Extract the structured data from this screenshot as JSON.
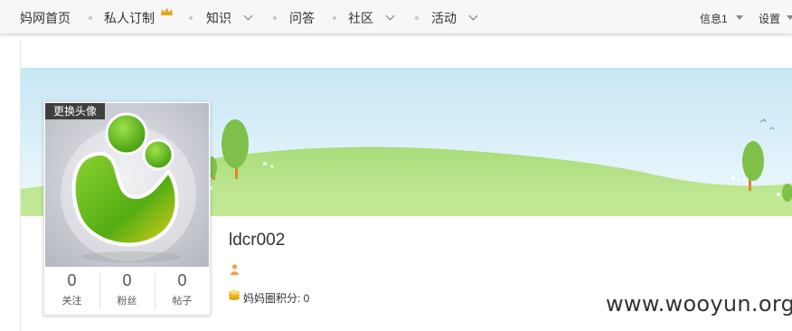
{
  "nav": {
    "items": [
      "妈网首页",
      "私人订制",
      "知识",
      "问答",
      "社区",
      "活动"
    ],
    "right": {
      "messages": "信息1",
      "settings": "设置"
    }
  },
  "profile": {
    "change_avatar": "更换头像",
    "username": "ldcr002",
    "stats": [
      {
        "value": "0",
        "label": "关注"
      },
      {
        "value": "0",
        "label": "粉丝"
      },
      {
        "value": "0",
        "label": "帖子"
      }
    ],
    "points_label": "妈妈圈积分: ",
    "points_value": "0"
  },
  "watermark": "www.wooyun.org"
}
